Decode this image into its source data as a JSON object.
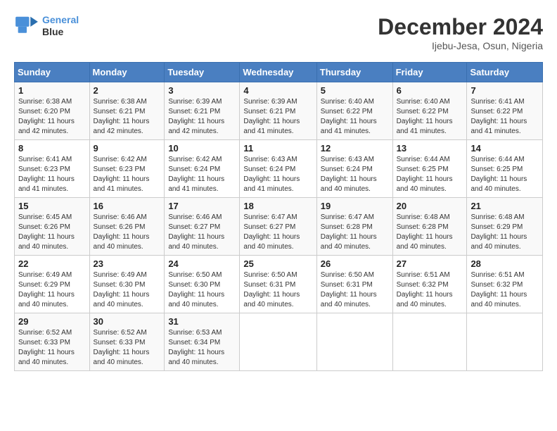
{
  "header": {
    "logo_line1": "General",
    "logo_line2": "Blue",
    "title": "December 2024",
    "subtitle": "Ijebu-Jesa, Osun, Nigeria"
  },
  "columns": [
    "Sunday",
    "Monday",
    "Tuesday",
    "Wednesday",
    "Thursday",
    "Friday",
    "Saturday"
  ],
  "weeks": [
    [
      {
        "day": "1",
        "sunrise": "6:38 AM",
        "sunset": "6:20 PM",
        "daylight": "11 hours and 42 minutes."
      },
      {
        "day": "2",
        "sunrise": "6:38 AM",
        "sunset": "6:21 PM",
        "daylight": "11 hours and 42 minutes."
      },
      {
        "day": "3",
        "sunrise": "6:39 AM",
        "sunset": "6:21 PM",
        "daylight": "11 hours and 42 minutes."
      },
      {
        "day": "4",
        "sunrise": "6:39 AM",
        "sunset": "6:21 PM",
        "daylight": "11 hours and 41 minutes."
      },
      {
        "day": "5",
        "sunrise": "6:40 AM",
        "sunset": "6:22 PM",
        "daylight": "11 hours and 41 minutes."
      },
      {
        "day": "6",
        "sunrise": "6:40 AM",
        "sunset": "6:22 PM",
        "daylight": "11 hours and 41 minutes."
      },
      {
        "day": "7",
        "sunrise": "6:41 AM",
        "sunset": "6:22 PM",
        "daylight": "11 hours and 41 minutes."
      }
    ],
    [
      {
        "day": "8",
        "sunrise": "6:41 AM",
        "sunset": "6:23 PM",
        "daylight": "11 hours and 41 minutes."
      },
      {
        "day": "9",
        "sunrise": "6:42 AM",
        "sunset": "6:23 PM",
        "daylight": "11 hours and 41 minutes."
      },
      {
        "day": "10",
        "sunrise": "6:42 AM",
        "sunset": "6:24 PM",
        "daylight": "11 hours and 41 minutes."
      },
      {
        "day": "11",
        "sunrise": "6:43 AM",
        "sunset": "6:24 PM",
        "daylight": "11 hours and 41 minutes."
      },
      {
        "day": "12",
        "sunrise": "6:43 AM",
        "sunset": "6:24 PM",
        "daylight": "11 hours and 40 minutes."
      },
      {
        "day": "13",
        "sunrise": "6:44 AM",
        "sunset": "6:25 PM",
        "daylight": "11 hours and 40 minutes."
      },
      {
        "day": "14",
        "sunrise": "6:44 AM",
        "sunset": "6:25 PM",
        "daylight": "11 hours and 40 minutes."
      }
    ],
    [
      {
        "day": "15",
        "sunrise": "6:45 AM",
        "sunset": "6:26 PM",
        "daylight": "11 hours and 40 minutes."
      },
      {
        "day": "16",
        "sunrise": "6:46 AM",
        "sunset": "6:26 PM",
        "daylight": "11 hours and 40 minutes."
      },
      {
        "day": "17",
        "sunrise": "6:46 AM",
        "sunset": "6:27 PM",
        "daylight": "11 hours and 40 minutes."
      },
      {
        "day": "18",
        "sunrise": "6:47 AM",
        "sunset": "6:27 PM",
        "daylight": "11 hours and 40 minutes."
      },
      {
        "day": "19",
        "sunrise": "6:47 AM",
        "sunset": "6:28 PM",
        "daylight": "11 hours and 40 minutes."
      },
      {
        "day": "20",
        "sunrise": "6:48 AM",
        "sunset": "6:28 PM",
        "daylight": "11 hours and 40 minutes."
      },
      {
        "day": "21",
        "sunrise": "6:48 AM",
        "sunset": "6:29 PM",
        "daylight": "11 hours and 40 minutes."
      }
    ],
    [
      {
        "day": "22",
        "sunrise": "6:49 AM",
        "sunset": "6:29 PM",
        "daylight": "11 hours and 40 minutes."
      },
      {
        "day": "23",
        "sunrise": "6:49 AM",
        "sunset": "6:30 PM",
        "daylight": "11 hours and 40 minutes."
      },
      {
        "day": "24",
        "sunrise": "6:50 AM",
        "sunset": "6:30 PM",
        "daylight": "11 hours and 40 minutes."
      },
      {
        "day": "25",
        "sunrise": "6:50 AM",
        "sunset": "6:31 PM",
        "daylight": "11 hours and 40 minutes."
      },
      {
        "day": "26",
        "sunrise": "6:50 AM",
        "sunset": "6:31 PM",
        "daylight": "11 hours and 40 minutes."
      },
      {
        "day": "27",
        "sunrise": "6:51 AM",
        "sunset": "6:32 PM",
        "daylight": "11 hours and 40 minutes."
      },
      {
        "day": "28",
        "sunrise": "6:51 AM",
        "sunset": "6:32 PM",
        "daylight": "11 hours and 40 minutes."
      }
    ],
    [
      {
        "day": "29",
        "sunrise": "6:52 AM",
        "sunset": "6:33 PM",
        "daylight": "11 hours and 40 minutes."
      },
      {
        "day": "30",
        "sunrise": "6:52 AM",
        "sunset": "6:33 PM",
        "daylight": "11 hours and 40 minutes."
      },
      {
        "day": "31",
        "sunrise": "6:53 AM",
        "sunset": "6:34 PM",
        "daylight": "11 hours and 40 minutes."
      },
      null,
      null,
      null,
      null
    ]
  ]
}
